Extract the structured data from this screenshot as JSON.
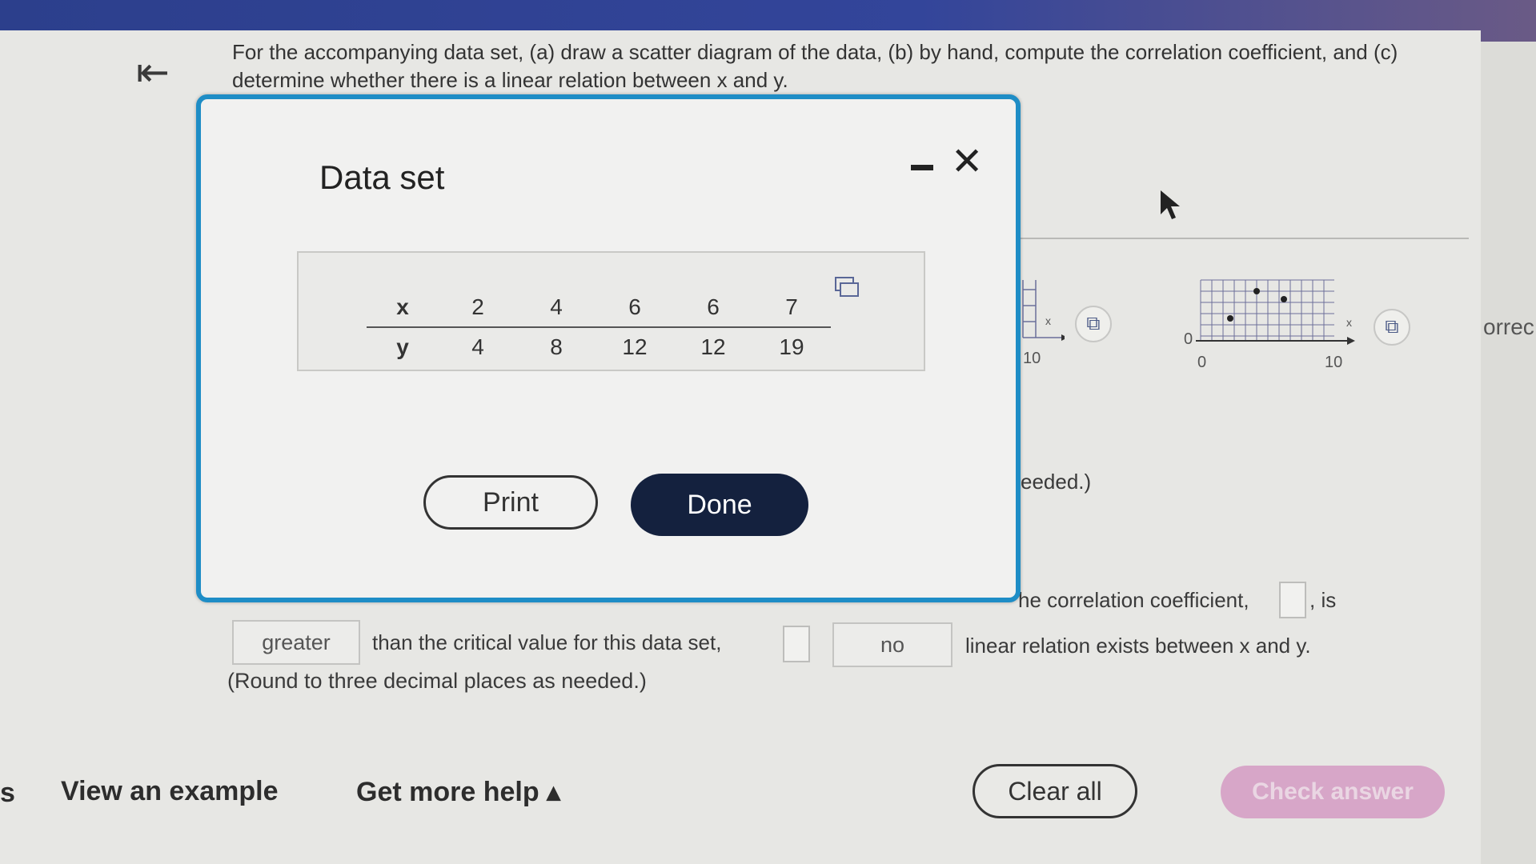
{
  "question": {
    "text": "For the accompanying data set, (a) draw a scatter diagram of the data, (b) by hand, compute the correlation coefficient, and (c) determine whether there is a linear relation between x and y."
  },
  "graphs": {
    "left_thumb_tick": "10",
    "right_thumb_origin_y": "0",
    "right_thumb_origin_x": "0",
    "right_thumb_tick": "10",
    "axis_label": "x",
    "cut_right_text": "orrec"
  },
  "background_text": {
    "needed": "eeded.)",
    "correlation_prefix": "he correlation coefficient,",
    "correlation_suffix": ", is",
    "than_critical": "than the critical value for this data set,",
    "linear_relation": "linear relation exists between x and y.",
    "round_note": "(Round to three decimal places as needed.)"
  },
  "answers": {
    "comparison": "greater",
    "exists": "no"
  },
  "footer": {
    "view_example": "View an example",
    "get_help": "Get more help ▴",
    "clear_all": "Clear all",
    "check_answer": "Check answer",
    "left_edge": "s"
  },
  "modal": {
    "title": "Data set",
    "x_label": "x",
    "y_label": "y",
    "x_values": [
      "2",
      "4",
      "6",
      "6",
      "7"
    ],
    "y_values": [
      "4",
      "8",
      "12",
      "12",
      "19"
    ],
    "print_label": "Print",
    "done_label": "Done"
  },
  "colors": {
    "modal_border": "#1e8dc6",
    "done_button": "#14213e",
    "check_answer_disabled": "#d7a6c8"
  }
}
